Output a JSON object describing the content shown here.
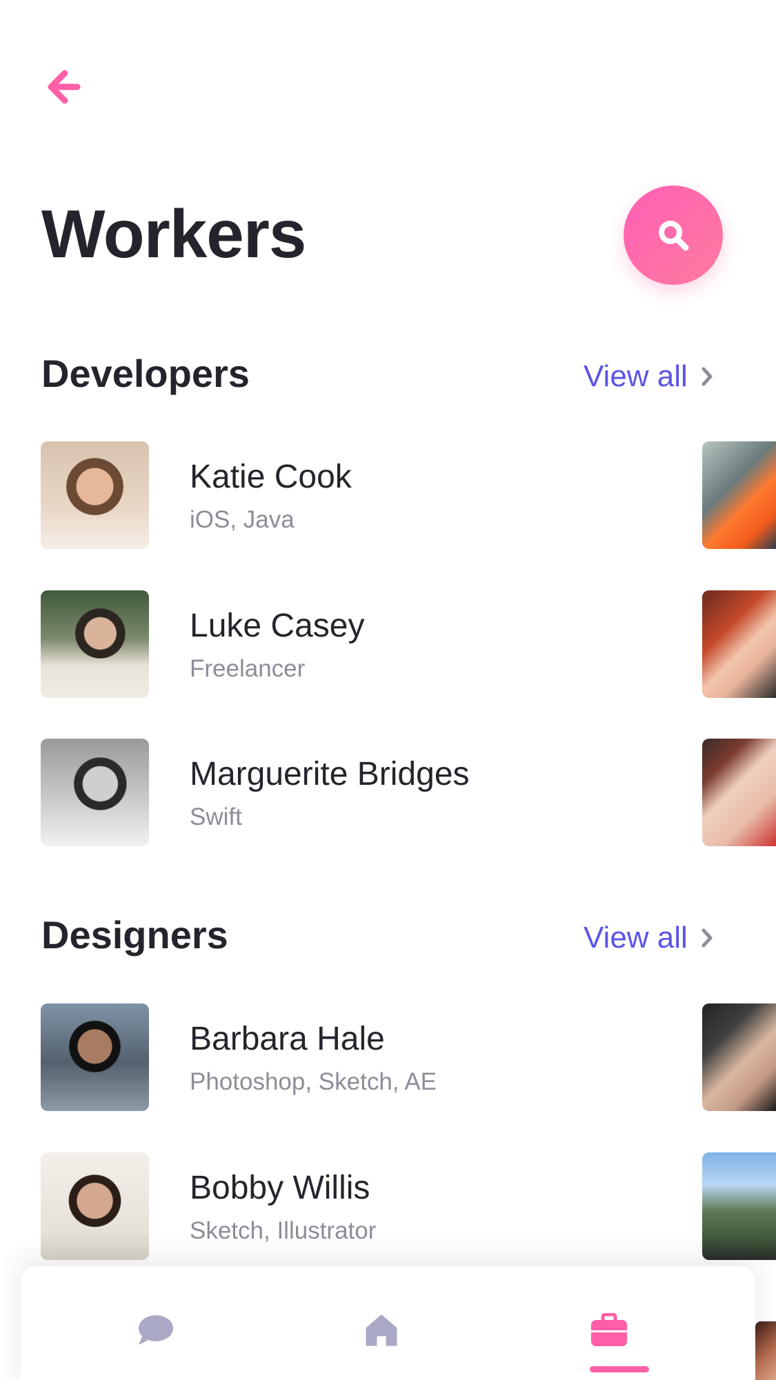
{
  "header": {
    "title": "Workers",
    "back_icon": "back-arrow-icon",
    "search_icon": "search-icon"
  },
  "colors": {
    "accent_pink": "#ff5fa6",
    "link_blue": "#5b55e6",
    "text_dark": "#24242c",
    "text_muted": "#8d8d99",
    "nav_inactive": "#a9a9c6"
  },
  "sections": [
    {
      "title": "Developers",
      "view_all": "View all",
      "workers": [
        {
          "name": "Katie Cook",
          "skills": "iOS, Java"
        },
        {
          "name": "Luke Casey",
          "skills": "Freelancer"
        },
        {
          "name": "Marguerite Bridges",
          "skills": "Swift"
        }
      ]
    },
    {
      "title": "Designers",
      "view_all": "View all",
      "workers": [
        {
          "name": "Barbara Hale",
          "skills": "Photoshop, Sketch, AE"
        },
        {
          "name": "Bobby Willis",
          "skills": "Sketch, Illustrator"
        }
      ]
    }
  ],
  "bottom_nav": {
    "items": [
      {
        "icon": "chat-bubble-icon",
        "active": false
      },
      {
        "icon": "home-icon",
        "active": false
      },
      {
        "icon": "briefcase-icon",
        "active": true
      }
    ]
  }
}
